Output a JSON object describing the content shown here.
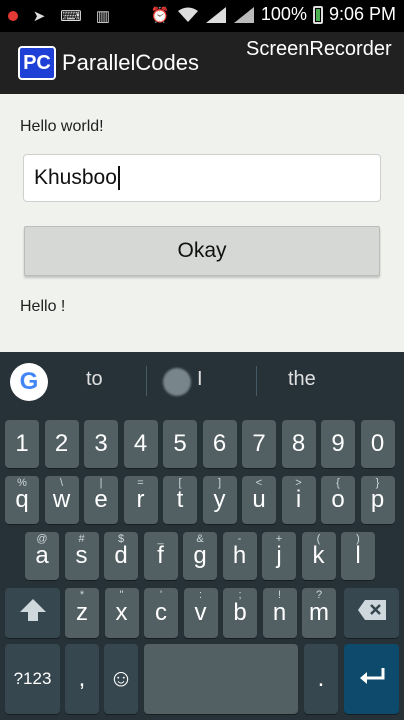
{
  "status_bar": {
    "battery_percent": "100%",
    "time": "9:06 PM"
  },
  "action_bar": {
    "icon_text": "PC",
    "title": "ParallelCodes",
    "overlay_label": "ScreenRecorder"
  },
  "main": {
    "greeting": "Hello world!",
    "name_field_value": "Khusboo",
    "okay_button": "Okay",
    "result_text": "Hello !"
  },
  "keyboard": {
    "google_logo": "G",
    "suggestions": [
      "to",
      "I",
      "the"
    ],
    "number_row": [
      "1",
      "2",
      "3",
      "4",
      "5",
      "6",
      "7",
      "8",
      "9",
      "0"
    ],
    "row1": {
      "keys": [
        "q",
        "w",
        "e",
        "r",
        "t",
        "y",
        "u",
        "i",
        "o",
        "p"
      ],
      "hints": [
        "%",
        "\\",
        "|",
        "=",
        "[",
        "]",
        "<",
        ">",
        "{",
        "}"
      ]
    },
    "row2": {
      "keys": [
        "a",
        "s",
        "d",
        "f",
        "g",
        "h",
        "j",
        "k",
        "l"
      ],
      "hints": [
        "@",
        "#",
        "$",
        "_",
        "&",
        "-",
        "+",
        "(",
        ")"
      ]
    },
    "row3": {
      "keys": [
        "z",
        "x",
        "c",
        "v",
        "b",
        "n",
        "m"
      ],
      "hints": [
        "*",
        "\"",
        "'",
        ":",
        ";",
        "!",
        "?"
      ]
    },
    "symbols_key": "?123",
    "comma_key": ",",
    "emoji_key": "☺",
    "period_key": ".",
    "shift_icon": "shift-icon",
    "backspace_icon": "backspace-icon",
    "enter_icon": "enter-icon"
  }
}
